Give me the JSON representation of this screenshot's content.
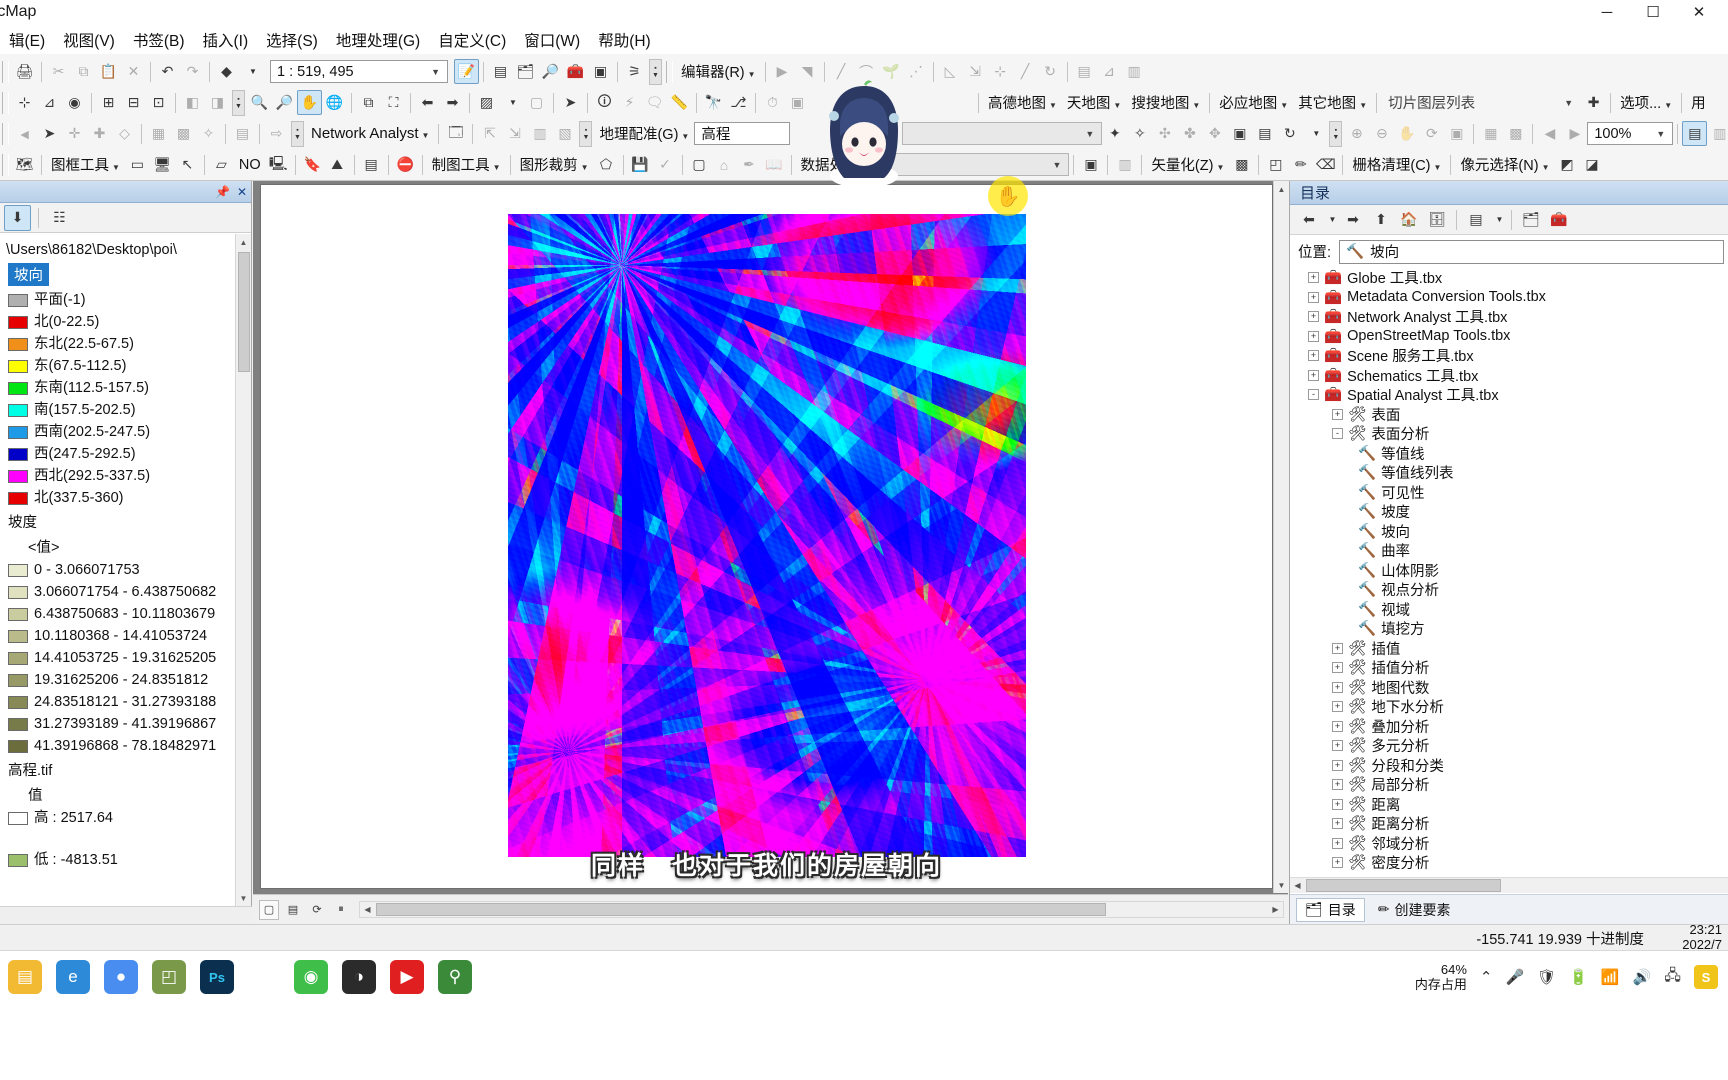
{
  "window": {
    "title": "rcMap",
    "minimize": "─",
    "maximize": "☐",
    "close": "✕"
  },
  "menubar": [
    {
      "label": "辑(E)"
    },
    {
      "label": "视图(V)"
    },
    {
      "label": "书签(B)"
    },
    {
      "label": "插入(I)"
    },
    {
      "label": "选择(S)"
    },
    {
      "label": "地理处理(G)"
    },
    {
      "label": "自定义(C)"
    },
    {
      "label": "窗口(W)"
    },
    {
      "label": "帮助(H)"
    }
  ],
  "toolbars": {
    "scale_value": "1 : 519, 495",
    "editor_label": "编辑器(R)",
    "network_analyst_label": "Network Analyst",
    "georef_label": "地理配准(G)",
    "georef_layer": "高程",
    "frame_tool_label": "图框工具",
    "no_label": "NO",
    "maptool_label": "制图工具",
    "clip_label": "图形裁剪",
    "dataproc_label": "数据处理",
    "amap_label": "高德地图",
    "tianditu_label": "天地图",
    "sosomap_label": "搜搜地图",
    "bingmap_label": "必应地图",
    "othermap_label": "其它地图",
    "tilelist_label": "切片图层列表",
    "options_label": "选项...",
    "user_label": "用",
    "zoom_value": "100%",
    "vector_label": "矢量化(Z)",
    "raster_clean_label": "栅格清理(C)",
    "pixel_select_label": "像元选择(N)",
    "empty_combo": ""
  },
  "toc": {
    "path": "\\Users\\86182\\Desktop\\poi\\",
    "layer_aspect": "坡向",
    "aspect_classes": [
      {
        "label": "平面(-1)",
        "color": "#b0b0b0"
      },
      {
        "label": "北(0-22.5)",
        "color": "#e60000"
      },
      {
        "label": "东北(22.5-67.5)",
        "color": "#f0901a"
      },
      {
        "label": "东(67.5-112.5)",
        "color": "#ffff00"
      },
      {
        "label": "东南(112.5-157.5)",
        "color": "#00e612"
      },
      {
        "label": "南(157.5-202.5)",
        "color": "#00ffe5"
      },
      {
        "label": "西南(202.5-247.5)",
        "color": "#1e9ae6"
      },
      {
        "label": "西(247.5-292.5)",
        "color": "#0000c8"
      },
      {
        "label": "西北(292.5-337.5)",
        "color": "#ff00ff"
      },
      {
        "label": "北(337.5-360)",
        "color": "#e60000"
      }
    ],
    "layer_slope": "坡度",
    "slope_value_header": "<值>",
    "slope_classes": [
      {
        "label": "0 - 3.066071753",
        "color": "#e9ecd0"
      },
      {
        "label": "3.066071754 - 6.438750682",
        "color": "#dfe1bf"
      },
      {
        "label": "6.438750683 - 10.11803679",
        "color": "#c9cc9e"
      },
      {
        "label": "10.1180368 - 14.41053724",
        "color": "#b9bb8b"
      },
      {
        "label": "14.41053725 - 19.31625205",
        "color": "#a6a876"
      },
      {
        "label": "19.31625206 - 24.8351812",
        "color": "#979a66"
      },
      {
        "label": "24.83518121 - 31.27393188",
        "color": "#878a57"
      },
      {
        "label": "31.27393189 - 41.39196867",
        "color": "#777a49"
      },
      {
        "label": "41.39196868 - 78.18482971",
        "color": "#6b6e3c"
      }
    ],
    "layer_dem": "高程.tif",
    "dem_value_header": "值",
    "dem_high": "高 : 2517.64",
    "dem_low": "低 : -4813.51",
    "dem_high_color": "#ffffff",
    "dem_low_color": "#9bbf6a"
  },
  "map": {
    "subtitle": "同样　也对于我们的房屋朝向"
  },
  "catalog": {
    "title": "目录",
    "location_label": "位置:",
    "location_value": "坡向",
    "tree": [
      {
        "label": "Globe 工具.tbx",
        "indent": 1,
        "expander": "+",
        "icon": "toolbox"
      },
      {
        "label": "Metadata Conversion Tools.tbx",
        "indent": 1,
        "expander": "+",
        "icon": "toolbox"
      },
      {
        "label": "Network Analyst 工具.tbx",
        "indent": 1,
        "expander": "+",
        "icon": "toolbox"
      },
      {
        "label": "OpenStreetMap Tools.tbx",
        "indent": 1,
        "expander": "+",
        "icon": "toolbox"
      },
      {
        "label": "Scene 服务工具.tbx",
        "indent": 1,
        "expander": "+",
        "icon": "toolbox"
      },
      {
        "label": "Schematics 工具.tbx",
        "indent": 1,
        "expander": "+",
        "icon": "toolbox"
      },
      {
        "label": "Spatial Analyst 工具.tbx",
        "indent": 1,
        "expander": "-",
        "icon": "toolbox"
      },
      {
        "label": "表面",
        "indent": 2,
        "expander": "+",
        "icon": "toolset"
      },
      {
        "label": "表面分析",
        "indent": 2,
        "expander": "-",
        "icon": "toolset"
      },
      {
        "label": "等值线",
        "indent": 3,
        "expander": "",
        "icon": "tool"
      },
      {
        "label": "等值线列表",
        "indent": 3,
        "expander": "",
        "icon": "tool"
      },
      {
        "label": "可见性",
        "indent": 3,
        "expander": "",
        "icon": "tool"
      },
      {
        "label": "坡度",
        "indent": 3,
        "expander": "",
        "icon": "tool"
      },
      {
        "label": "坡向",
        "indent": 3,
        "expander": "",
        "icon": "tool"
      },
      {
        "label": "曲率",
        "indent": 3,
        "expander": "",
        "icon": "tool"
      },
      {
        "label": "山体阴影",
        "indent": 3,
        "expander": "",
        "icon": "tool"
      },
      {
        "label": "视点分析",
        "indent": 3,
        "expander": "",
        "icon": "tool"
      },
      {
        "label": "视域",
        "indent": 3,
        "expander": "",
        "icon": "tool"
      },
      {
        "label": "填挖方",
        "indent": 3,
        "expander": "",
        "icon": "tool"
      },
      {
        "label": "插值",
        "indent": 2,
        "expander": "+",
        "icon": "toolset"
      },
      {
        "label": "插值分析",
        "indent": 2,
        "expander": "+",
        "icon": "toolset"
      },
      {
        "label": "地图代数",
        "indent": 2,
        "expander": "+",
        "icon": "toolset"
      },
      {
        "label": "地下水分析",
        "indent": 2,
        "expander": "+",
        "icon": "toolset"
      },
      {
        "label": "叠加分析",
        "indent": 2,
        "expander": "+",
        "icon": "toolset"
      },
      {
        "label": "多元分析",
        "indent": 2,
        "expander": "+",
        "icon": "toolset"
      },
      {
        "label": "分段和分类",
        "indent": 2,
        "expander": "+",
        "icon": "toolset"
      },
      {
        "label": "局部分析",
        "indent": 2,
        "expander": "+",
        "icon": "toolset"
      },
      {
        "label": "距离",
        "indent": 2,
        "expander": "+",
        "icon": "toolset"
      },
      {
        "label": "距离分析",
        "indent": 2,
        "expander": "+",
        "icon": "toolset"
      },
      {
        "label": "邻域分析",
        "indent": 2,
        "expander": "+",
        "icon": "toolset"
      },
      {
        "label": "密度分析",
        "indent": 2,
        "expander": "+",
        "icon": "toolset"
      }
    ],
    "tabs": [
      {
        "label": "目录",
        "selected": true
      },
      {
        "label": "创建要素",
        "selected": false
      }
    ]
  },
  "status": {
    "coordinates": "-155.741  19.939 十进制度"
  },
  "taskbar": {
    "apps": [
      {
        "name": "explorer-icon",
        "glyph": "▤",
        "color": "#f2b933"
      },
      {
        "name": "edge-icon",
        "glyph": "e",
        "color": "#2d8ad8"
      },
      {
        "name": "chrome-icon",
        "glyph": "●",
        "color": "#4a8df0"
      },
      {
        "name": "arcmap-icon",
        "glyph": "◰",
        "color": "#7a9a4a"
      },
      {
        "name": "photoshop-icon",
        "glyph": "Ps",
        "color": "#0b2f4f"
      },
      {
        "name": "wechat-icon",
        "glyph": "◉",
        "color": "#3fbf4a"
      },
      {
        "name": "bilibili-icon",
        "glyph": "◑",
        "color": "#2b2b2b"
      },
      {
        "name": "youtube-icon",
        "glyph": "▶",
        "color": "#e02020"
      },
      {
        "name": "search-app-icon",
        "glyph": "⚲",
        "color": "#3a8a3a"
      }
    ],
    "clock_time": "23:21",
    "clock_date": "2022/7",
    "cpu_percent": "64%",
    "cpu_label": "内存占用",
    "ime": "S"
  }
}
